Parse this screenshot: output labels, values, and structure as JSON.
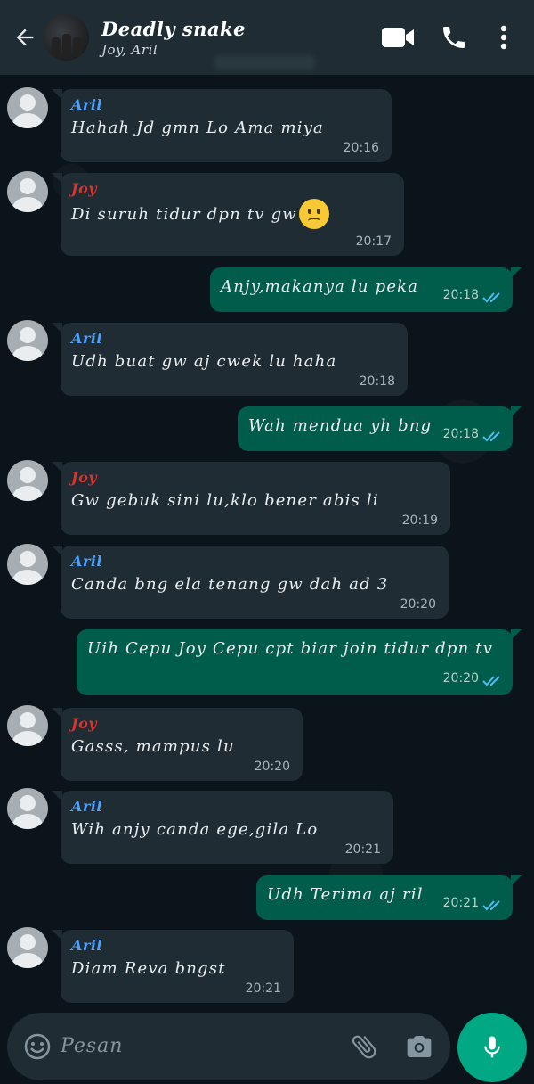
{
  "header": {
    "title": "Deadly snake",
    "subtitle": "Joy, Aril",
    "icons": [
      "back-arrow-icon",
      "video-call-icon",
      "phone-icon",
      "more-vert-icon"
    ]
  },
  "colors": {
    "aril": "#4ea2ff",
    "joy": "#e0312a",
    "outgoing_bubble": "#005c4b",
    "incoming_bubble": "#1f2c34",
    "read_ticks": "#53bdeb",
    "mic_button": "#00a884"
  },
  "messages": [
    {
      "dir": "in",
      "sender": "Aril",
      "text": "Hahah Jd gmn Lo Ama miya",
      "time": "20:16"
    },
    {
      "dir": "in",
      "sender": "Joy",
      "text": "Di suruh tidur dpn tv gw",
      "emoji": "sad-face",
      "time": "20:17"
    },
    {
      "dir": "out",
      "text": "Anjy,makanya lu peka",
      "time": "20:18",
      "status": "read"
    },
    {
      "dir": "in",
      "sender": "Aril",
      "text": "Udh buat gw aj cwek lu haha",
      "time": "20:18"
    },
    {
      "dir": "out",
      "text": "Wah mendua yh bng",
      "time": "20:18",
      "status": "read"
    },
    {
      "dir": "in",
      "sender": "Joy",
      "text": "Gw gebuk sini lu,klo bener abis li",
      "time": "20:19"
    },
    {
      "dir": "in",
      "sender": "Aril",
      "text": "Canda bng ela tenang gw dah ad 3",
      "time": "20:20"
    },
    {
      "dir": "out",
      "text": "Uih Cepu Joy Cepu cpt biar  join tidur dpn tv",
      "time": "20:20",
      "status": "read"
    },
    {
      "dir": "in",
      "sender": "Joy",
      "text": "Gasss, mampus lu",
      "time": "20:20"
    },
    {
      "dir": "in",
      "sender": "Aril",
      "text": "Wih anjy canda ege,gila Lo",
      "time": "20:21"
    },
    {
      "dir": "out",
      "text": "Udh Terima aj ril",
      "time": "20:21",
      "status": "read"
    },
    {
      "dir": "in",
      "sender": "Aril",
      "text": "Diam Reva bngst",
      "time": "20:21"
    }
  ],
  "composer": {
    "placeholder": "Pesan",
    "icons": [
      "emoji-icon",
      "attach-icon",
      "camera-icon",
      "mic-icon"
    ]
  }
}
